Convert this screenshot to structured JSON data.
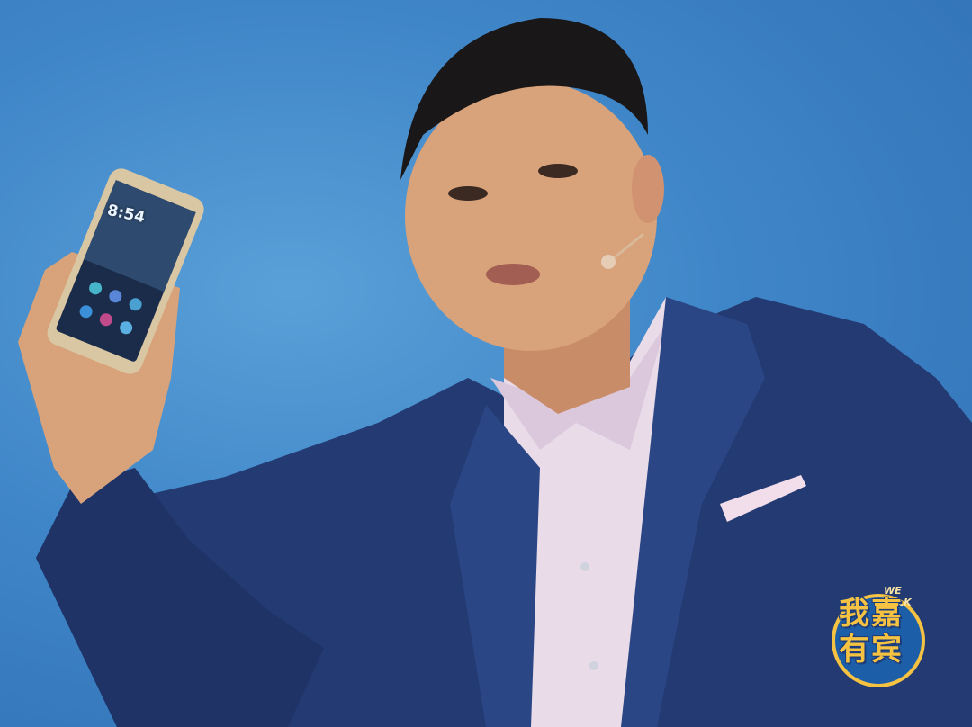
{
  "scene": {
    "description_tags": [
      "presenter",
      "smartphone",
      "stage"
    ],
    "colors": {
      "background": "#3f86c8",
      "suit": "#233a72",
      "shirt": "#e9dbe8",
      "skin": "#d8a27a",
      "phone_gold": "#d9c7a4",
      "logo_gold": "#f5c242",
      "logo_blue": "#1d5ea8"
    }
  },
  "phone": {
    "time": "8:54"
  },
  "logo": {
    "top_text": "WE TALK",
    "chars": "我嘉有宾"
  }
}
